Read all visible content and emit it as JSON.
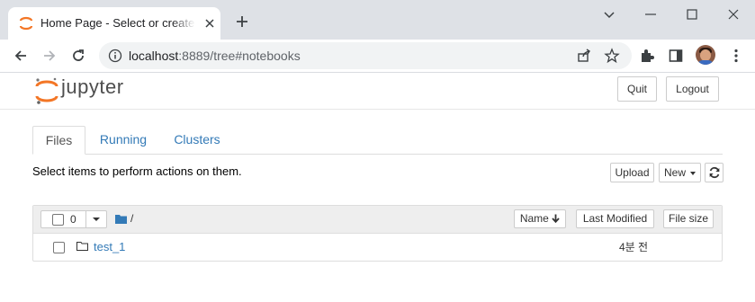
{
  "browser": {
    "tab_title": "Home Page - Select or create a notebook",
    "url_host": "localhost",
    "url_rest": ":8889/tree#notebooks",
    "accent_color": "#f37626"
  },
  "header": {
    "logo_text": "jupyter",
    "quit_label": "Quit",
    "logout_label": "Logout"
  },
  "tabs": [
    {
      "label": "Files",
      "active": true
    },
    {
      "label": "Running",
      "active": false
    },
    {
      "label": "Clusters",
      "active": false
    }
  ],
  "toolbar": {
    "hint": "Select items to perform actions on them.",
    "upload_label": "Upload",
    "new_label": "New"
  },
  "list": {
    "selected_count": "0",
    "breadcrumb": "/",
    "sort_name": "Name",
    "sort_modified": "Last Modified",
    "sort_size": "File size",
    "items": [
      {
        "name": "test_1",
        "modified": "4분 전",
        "type": "folder-icon"
      }
    ]
  }
}
